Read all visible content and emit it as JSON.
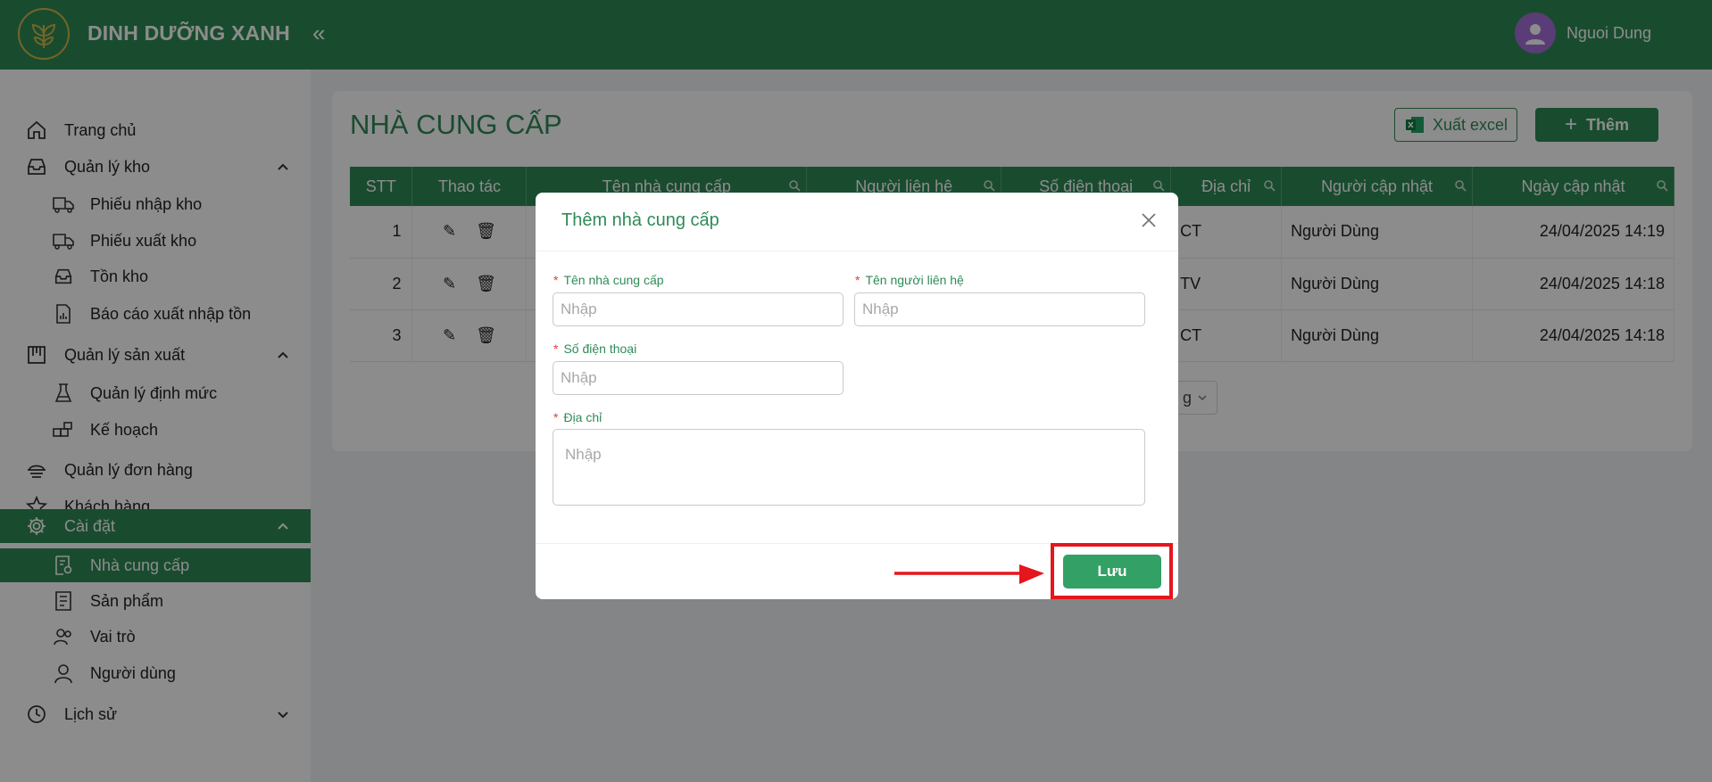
{
  "app": {
    "brand": "DINH DƯỠNG XANH",
    "user_name": "Nguoi Dung"
  },
  "sidebar": {
    "items": [
      {
        "label": "Trang chủ",
        "icon": "home-icon"
      },
      {
        "label": "Quản lý kho",
        "icon": "inbox-icon",
        "expanded": true
      },
      {
        "label": "Phiếu nhập kho",
        "icon": "truck-import-icon"
      },
      {
        "label": "Phiếu xuất kho",
        "icon": "truck-export-icon"
      },
      {
        "label": "Tồn kho",
        "icon": "inbox-icon"
      },
      {
        "label": "Báo cáo xuất nhập tồn",
        "icon": "report-icon"
      },
      {
        "label": "Quản lý sản xuất",
        "icon": "production-icon",
        "expanded": true
      },
      {
        "label": "Quản lý định mức",
        "icon": "flask-icon"
      },
      {
        "label": "Kế hoạch",
        "icon": "plan-icon"
      },
      {
        "label": "Quản lý đơn hàng",
        "icon": "order-icon"
      },
      {
        "label": "Khách hàng",
        "icon": "star-icon"
      },
      {
        "label": "Cài đặt",
        "icon": "gear-icon",
        "expanded": true,
        "active_group": true
      },
      {
        "label": "Nhà cung cấp",
        "icon": "supplier-icon",
        "active": true
      },
      {
        "label": "Sản phẩm",
        "icon": "product-icon"
      },
      {
        "label": "Vai trò",
        "icon": "role-icon"
      },
      {
        "label": "Người dùng",
        "icon": "user-icon"
      },
      {
        "label": "Lịch sử",
        "icon": "history-icon",
        "expanded": false
      }
    ]
  },
  "page": {
    "title": "NHÀ CUNG CẤP",
    "export_label": "Xuất excel",
    "add_label": "Thêm",
    "pager_text": "g"
  },
  "table": {
    "headers": [
      "STT",
      "Thao tác",
      "Tên nhà cung cấp",
      "Người liên hệ",
      "Số điện thoại",
      "Địa chỉ",
      "Người cập nhật",
      "Ngày cập nhật"
    ],
    "rows": [
      {
        "stt": "1",
        "address": "CT",
        "updated_by": "Người Dùng",
        "updated_at": "24/04/2025 14:19"
      },
      {
        "stt": "2",
        "address": "TV",
        "updated_by": "Người Dùng",
        "updated_at": "24/04/2025 14:18"
      },
      {
        "stt": "3",
        "address": "CT",
        "updated_by": "Người Dùng",
        "updated_at": "24/04/2025 14:18"
      }
    ]
  },
  "modal": {
    "title": "Thêm nhà cung cấp",
    "fields": {
      "supplier_name": {
        "label": "Tên nhà cung cấp",
        "placeholder": "Nhập",
        "value": ""
      },
      "contact_name": {
        "label": "Tên người liên hệ",
        "placeholder": "Nhập",
        "value": ""
      },
      "phone": {
        "label": "Số điện thoại",
        "placeholder": "Nhập",
        "value": ""
      },
      "address": {
        "label": "Địa chỉ",
        "placeholder": "Nhập",
        "value": ""
      }
    },
    "save_label": "Lưu"
  },
  "colors": {
    "primary": "#2e8b57",
    "save": "#33a065",
    "highlight": "#e5161d",
    "required": "#e53935"
  }
}
